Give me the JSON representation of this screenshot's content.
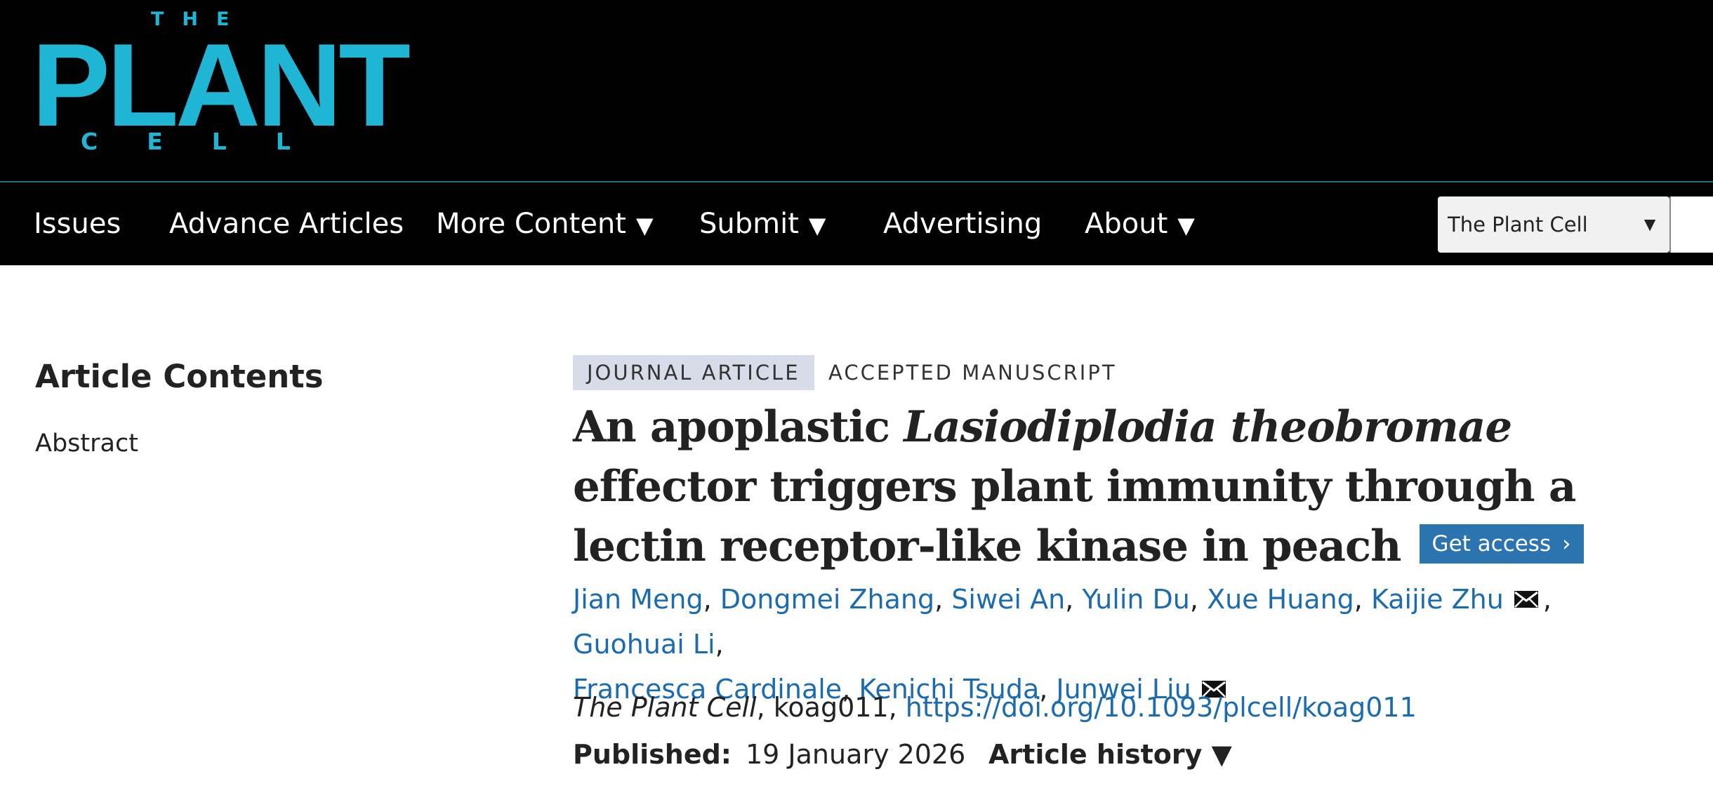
{
  "brand": {
    "logo_the": "THE",
    "logo_plant": "PLANT",
    "logo_cell": "CELL",
    "color": "#1fb6d6"
  },
  "nav": {
    "items": [
      {
        "label": "Issues",
        "has_dropdown": false
      },
      {
        "label": "Advance Articles",
        "has_dropdown": false
      },
      {
        "label": "More Content",
        "has_dropdown": true
      },
      {
        "label": "Submit",
        "has_dropdown": true
      },
      {
        "label": "Advertising",
        "has_dropdown": false
      },
      {
        "label": "About",
        "has_dropdown": true
      }
    ],
    "caret": "▼",
    "search_scope": {
      "selected": "The Plant Cell",
      "caret": "▼"
    }
  },
  "sidebar": {
    "title": "Article Contents",
    "links": [
      "Abstract"
    ]
  },
  "article": {
    "type_badge": "JOURNAL ARTICLE",
    "status_badge": "ACCEPTED MANUSCRIPT",
    "title_part1": "An apoplastic ",
    "title_italic": "Lasiodiplodia theobromae",
    "title_part2": " effector triggers plant immunity through a lectin receptor-like kinase in peach",
    "get_access": {
      "label": "Get access",
      "chevron": "›",
      "color": "#2b74b0"
    },
    "authors": [
      {
        "name": "Jian Meng",
        "corresponding": false
      },
      {
        "name": "Dongmei Zhang",
        "corresponding": false
      },
      {
        "name": "Siwei An",
        "corresponding": false
      },
      {
        "name": "Yulin Du",
        "corresponding": false
      },
      {
        "name": "Xue Huang",
        "corresponding": false
      },
      {
        "name": "Kaijie Zhu",
        "corresponding": true
      },
      {
        "name": "Guohuai Li",
        "corresponding": false
      },
      {
        "name": "Francesca Cardinale",
        "corresponding": false
      },
      {
        "name": "Kenichi Tsuda",
        "corresponding": false
      },
      {
        "name": "Junwei Liu",
        "corresponding": true
      }
    ],
    "link_color": "#1b6bb0",
    "citation": {
      "journal": "The Plant Cell",
      "id": "koag011",
      "doi": "https://doi.org/10.1093/plcell/koag011"
    },
    "published": {
      "label": "Published:",
      "date": "19 January 2026"
    },
    "history": {
      "label": "Article history",
      "caret": "▼"
    }
  }
}
